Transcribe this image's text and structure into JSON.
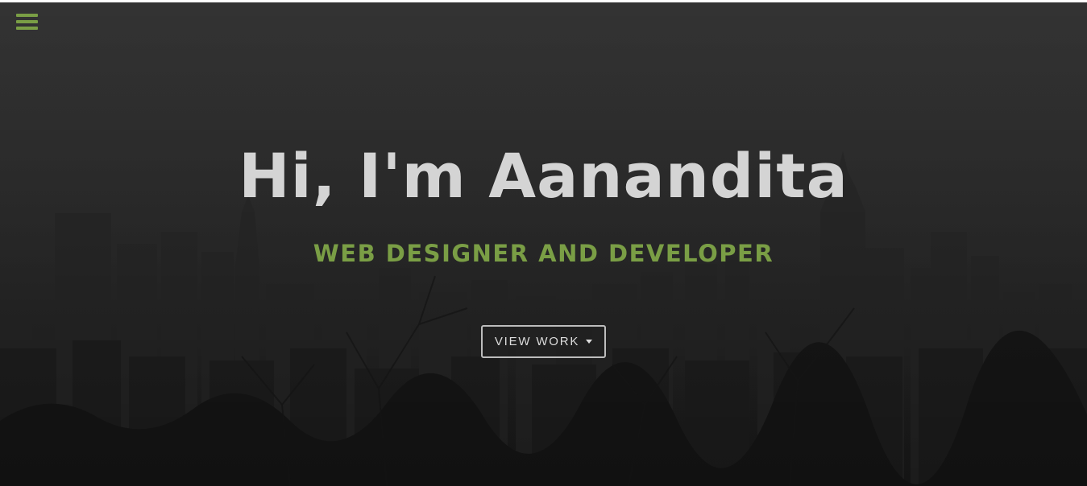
{
  "colors": {
    "accent": "#7a9e45",
    "title": "#d4d4d4",
    "background": "#303030"
  },
  "nav": {
    "menu_icon": "hamburger-menu-icon"
  },
  "hero": {
    "title": "Hi, I'm Aanandita",
    "subtitle": "WEB DESIGNER AND DEVELOPER",
    "cta_label": "VIEW WORK",
    "cta_icon": "caret-down-icon"
  }
}
